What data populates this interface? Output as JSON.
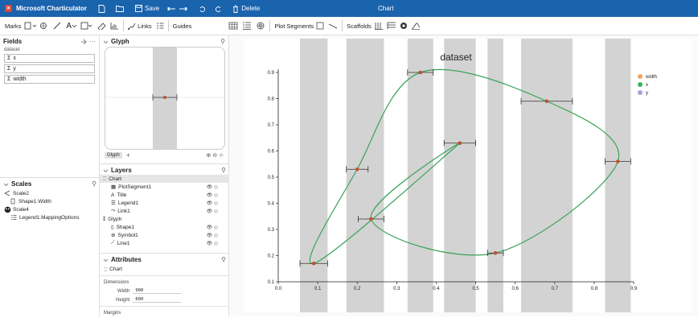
{
  "titlebar": {
    "app_name": "Microsoft Charticulator",
    "save_label": "Save",
    "delete_label": "Delete",
    "doc_title": "Chart"
  },
  "toolbar": {
    "marks_label": "Marks",
    "links_label": "Links",
    "guides_label": "Guides",
    "plot_segments_label": "Plot Segments",
    "scaffolds_label": "Scaffolds"
  },
  "fields": {
    "title": "Fields",
    "dataset_label": "dataset",
    "items": [
      "x",
      "y",
      "width"
    ]
  },
  "scales": {
    "title": "Scales",
    "items": [
      {
        "name": "Scale2",
        "child": "Shape1.Width"
      },
      {
        "name": "Scale4",
        "child": "Legend1.MappingOptions"
      }
    ]
  },
  "glyph": {
    "title": "Glyph",
    "tab_label": "Glyph",
    "add_label": "+"
  },
  "layers": {
    "title": "Layers",
    "items": [
      {
        "label": "Chart",
        "level": 0,
        "selected": true
      },
      {
        "label": "PlotSegment1",
        "level": 1
      },
      {
        "label": "Title",
        "level": 1
      },
      {
        "label": "Legend1",
        "level": 1
      },
      {
        "label": "Link1",
        "level": 1
      },
      {
        "label": "Glyph",
        "level": 0
      },
      {
        "label": "Shape1",
        "level": 1
      },
      {
        "label": "Symbol1",
        "level": 1
      },
      {
        "label": "Line1",
        "level": 1
      }
    ]
  },
  "attributes": {
    "title": "Attributes",
    "target": "Chart",
    "dimensions_label": "Dimensions",
    "width_label": "Width",
    "width_value": "900",
    "height_label": "Height",
    "height_value": "600",
    "margins_label": "Margins"
  },
  "chart_data": {
    "type": "scatter",
    "title": "dataset",
    "xlim": [
      0.0,
      0.9
    ],
    "ylim": [
      0.1,
      0.9
    ],
    "xticks": [
      "0.0",
      "0.1",
      "0.2",
      "0.3",
      "0.4",
      "0.5",
      "0.6",
      "0.7",
      "0.8",
      "0.9"
    ],
    "yticks": [
      "0.1",
      "0.2",
      "0.3",
      "0.4",
      "0.5",
      "0.6",
      "0.7",
      "0.8",
      "0.9"
    ],
    "points": [
      {
        "x": 0.09,
        "y": 0.17,
        "width": 0.07
      },
      {
        "x": 0.2,
        "y": 0.53,
        "width": 0.055
      },
      {
        "x": 0.36,
        "y": 0.9,
        "width": 0.065
      },
      {
        "x": 0.68,
        "y": 0.79,
        "width": 0.13
      },
      {
        "x": 0.86,
        "y": 0.56,
        "width": 0.065
      },
      {
        "x": 0.55,
        "y": 0.21,
        "width": 0.04
      },
      {
        "x": 0.235,
        "y": 0.34,
        "width": 0.065
      },
      {
        "x": 0.46,
        "y": 0.63,
        "width": 0.08
      }
    ],
    "path_order": [
      0,
      1,
      2,
      3,
      4,
      5,
      6,
      7
    ],
    "legend": [
      {
        "label": "width",
        "color": "#f4a460"
      },
      {
        "label": "x",
        "color": "#3cb35c"
      },
      {
        "label": "y",
        "color": "#b39ddb"
      }
    ],
    "colors": {
      "point": "#c1502e",
      "line": "#3aa35a",
      "band": "#d3d3d3"
    }
  }
}
